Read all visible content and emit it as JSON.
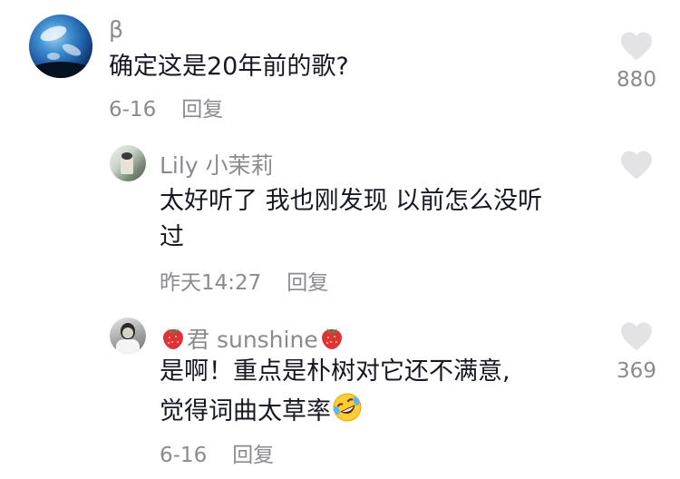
{
  "comments": [
    {
      "username": "β",
      "text": "确定这是20年前的歌?",
      "date": "6-16",
      "reply_label": "回复",
      "likes": "880",
      "avatar_icon": "earth-photo-avatar"
    },
    {
      "username": "Lily 小茉莉",
      "text_line1": "太好听了 我也刚发现 以前怎么没听",
      "text_line2": "过",
      "date": "昨天14:27",
      "reply_label": "回复",
      "likes": "",
      "avatar_icon": "person-photo-avatar"
    },
    {
      "username_prefix_icon": "strawberry-icon",
      "username": "君 sunshine",
      "username_suffix_icon": "strawberry-icon",
      "text_line1": "是啊！重点是朴树对它还不满意,",
      "text_line2": "觉得词曲太草率",
      "text_emoji": "rolling-laughing-emoji",
      "date": "6-16",
      "reply_label": "回复",
      "likes": "369",
      "avatar_icon": "person-photo-avatar"
    }
  ],
  "colors": {
    "text": "#161823",
    "secondary": "#8a8b91",
    "heart": "#e3e3e5"
  }
}
